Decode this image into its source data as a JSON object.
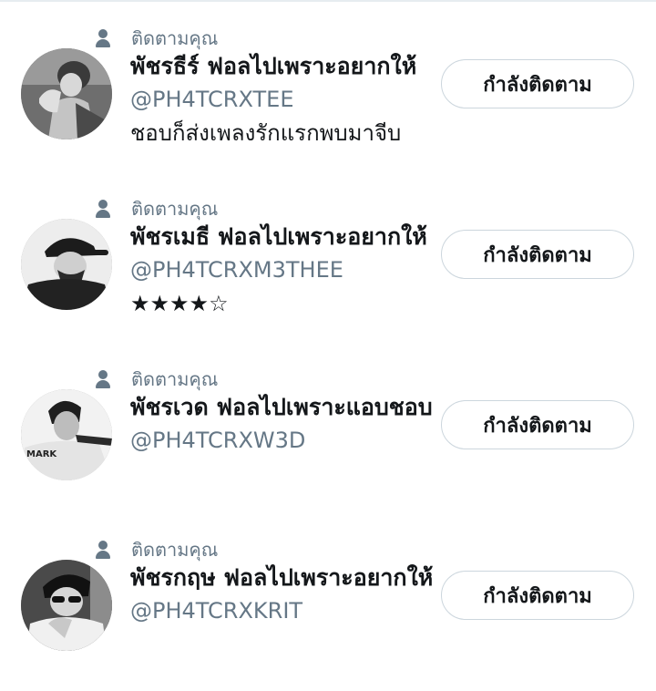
{
  "accounts": [
    {
      "follows_you": "ติดตามคุณ",
      "display_name": "พัชรธีร์ ฟอลไปเพราะอยากให้",
      "handle": "@PH4TCRXTEE",
      "bio": "ชอบก็ส่งเพลงรักแรกพบมาจีบ",
      "button_label": "กำลังติดตาม"
    },
    {
      "follows_you": "ติดตามคุณ",
      "display_name": "พัชรเมธี ฟอลไปเพราะอยากให้",
      "handle": "@PH4TCRXM3THEE",
      "bio": "★★★★☆",
      "button_label": "กำลังติดตาม"
    },
    {
      "follows_you": "ติดตามคุณ",
      "display_name": "พัชรเวด ฟอลไปเพราะแอบชอบ",
      "handle": "@PH4TCRXW3D",
      "avatar_text": "MARK",
      "button_label": "กำลังติดตาม"
    },
    {
      "follows_you": "ติดตามคุณ",
      "display_name": "พัชรกฤษ ฟอลไปเพราะอยากให้",
      "handle": "@PH4TCRXKRIT",
      "button_label": "กำลังติดตาม"
    }
  ]
}
